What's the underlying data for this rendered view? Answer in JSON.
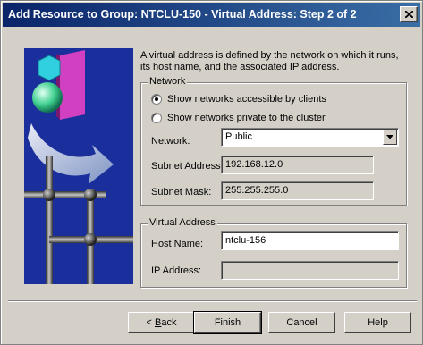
{
  "window": {
    "title": "Add Resource to Group: NTCLU-150   - Virtual Address:  Step 2 of 2"
  },
  "description": "A virtual address is defined by the network on which it runs, its host name, and the associated IP address.",
  "network_group": {
    "legend": "Network",
    "radio_clients": "Show networks accessible by clients",
    "radio_private": "Show networks private to the cluster",
    "selected_radio": "clients",
    "network_label": "Network:",
    "network_value": "Public",
    "subnet_address_label": "Subnet Address:",
    "subnet_address_value": "192.168.12.0",
    "subnet_mask_label": "Subnet Mask:",
    "subnet_mask_value": "255.255.255.0"
  },
  "virtual_group": {
    "legend": "Virtual Address",
    "host_name_label": "Host Name:",
    "host_name_value": "ntclu-156",
    "ip_address_label": "IP Address:",
    "ip_address_value": ""
  },
  "buttons": {
    "back_prefix": "< ",
    "back_mnemonic": "B",
    "back_rest": "ack",
    "finish": "Finish",
    "cancel": "Cancel",
    "help": "Help"
  },
  "icons": [
    "close-icon",
    "dropdown-arrow-icon",
    "wizard-network-illustration"
  ],
  "colors": {
    "titlebar_start": "#0a246a",
    "titlebar_end": "#3a6ea5",
    "dialog_face": "#d4d0c8",
    "art_background": "#1a2f9c"
  }
}
